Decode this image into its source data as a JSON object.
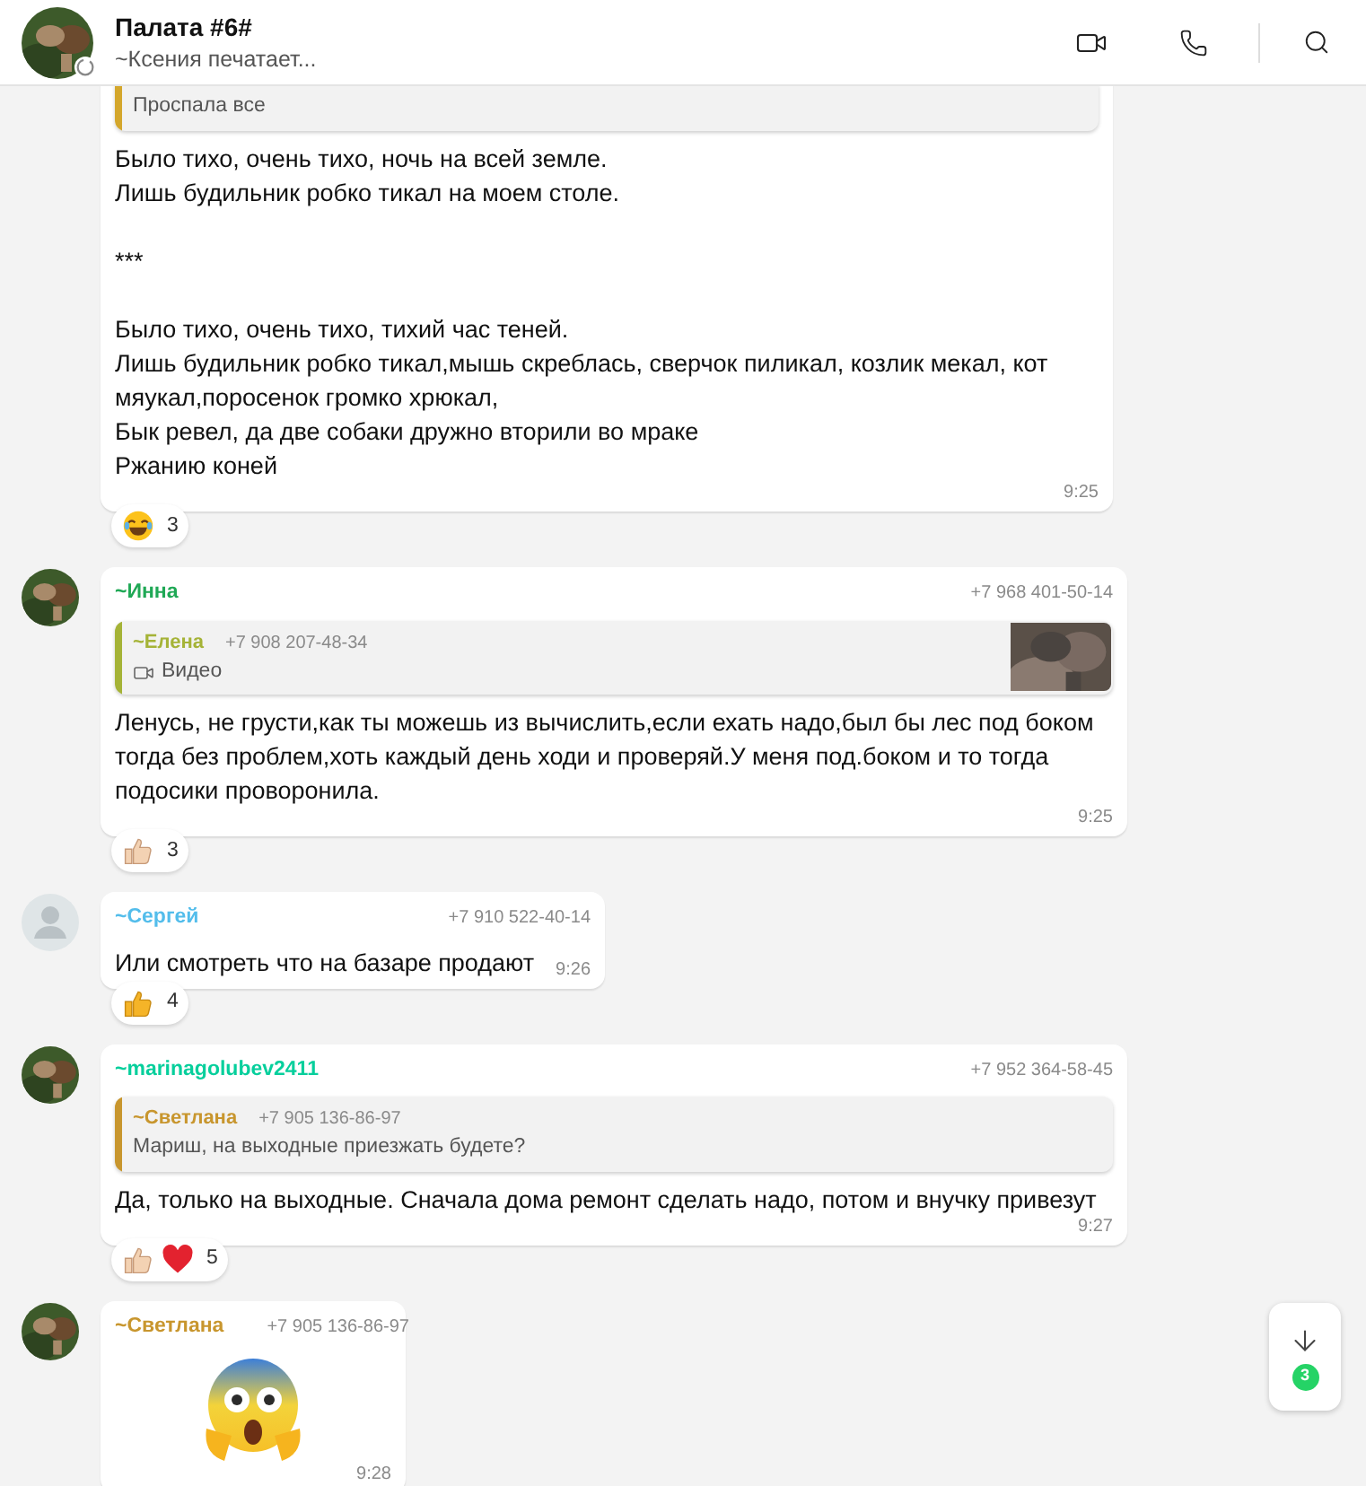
{
  "header": {
    "title": "Палата #6#",
    "status": "~Ксения печатает..."
  },
  "messages": [
    {
      "quote": {
        "text": "Проспала все",
        "color": "#d4a72c"
      },
      "text": "Было тихо, очень тихо, ночь на всей земле.\nЛишь будильник робко тикал на моем столе.\n\n***\n\nБыло тихо, очень тихо, тихий час теней.\nЛишь будильник робко тикал,мышь скреблась, сверчок пиликал, козлик мекал, кот мяукал,поросенок громко хрюкал,\nБык ревел, да две собаки дружно вторили во мраке\nРжанию коней",
      "time": "9:25",
      "reactions": {
        "items": [
          {
            "kind": "laugh"
          }
        ],
        "count": "3"
      }
    },
    {
      "sender": {
        "name": "~Инна",
        "phone": "+7 968 401-50-14",
        "color": "#1fa855"
      },
      "quote": {
        "name": "~Елена",
        "phone": "+7 908 207-48-34",
        "color": "#a5b337",
        "media": "Видео"
      },
      "text": "Ленусь, не грусти,как ты можешь из вычислить,если ехать надо,был бы лес под боком тогда без проблем,хоть каждый день ходи и проверяй.У меня под.боком и то тогда подосики проворонила.",
      "time": "9:25",
      "reactions": {
        "items": [
          {
            "kind": "thumbs-up-light"
          }
        ],
        "count": "3"
      }
    },
    {
      "sender": {
        "name": "~Сергей",
        "phone": "+7 910 522-40-14",
        "color": "#53bdeb",
        "avatar": {
          "kind": "default"
        }
      },
      "text": "Или смотреть что на базаре продают",
      "time": "9:26",
      "inline_time": true,
      "reactions": {
        "items": [
          {
            "kind": "thumbs-up"
          }
        ],
        "count": "4"
      }
    },
    {
      "sender": {
        "name": "~marinagolubev2411",
        "phone": "+7 952 364-58-45",
        "color": "#06cf9c"
      },
      "quote": {
        "name": "~Светлана",
        "phone": "+7 905 136-86-97",
        "color": "#c8962e",
        "text": "Мариш, на выходные приезжать будете?"
      },
      "text": "Да, только на выходные. Сначала дома ремонт сделать надо, потом и внучку привезут",
      "time": "9:27",
      "reactions": {
        "items": [
          {
            "kind": "thumbs-up-light"
          },
          {
            "kind": "heart"
          }
        ],
        "count": "5"
      }
    },
    {
      "sender": {
        "name": "~Светлана",
        "phone": "+7 905 136-86-97",
        "color": "#c8962e"
      },
      "sticker": {
        "kind": "screaming-face"
      },
      "time": "9:28"
    }
  ],
  "scroll_button": {
    "unread": "3"
  }
}
